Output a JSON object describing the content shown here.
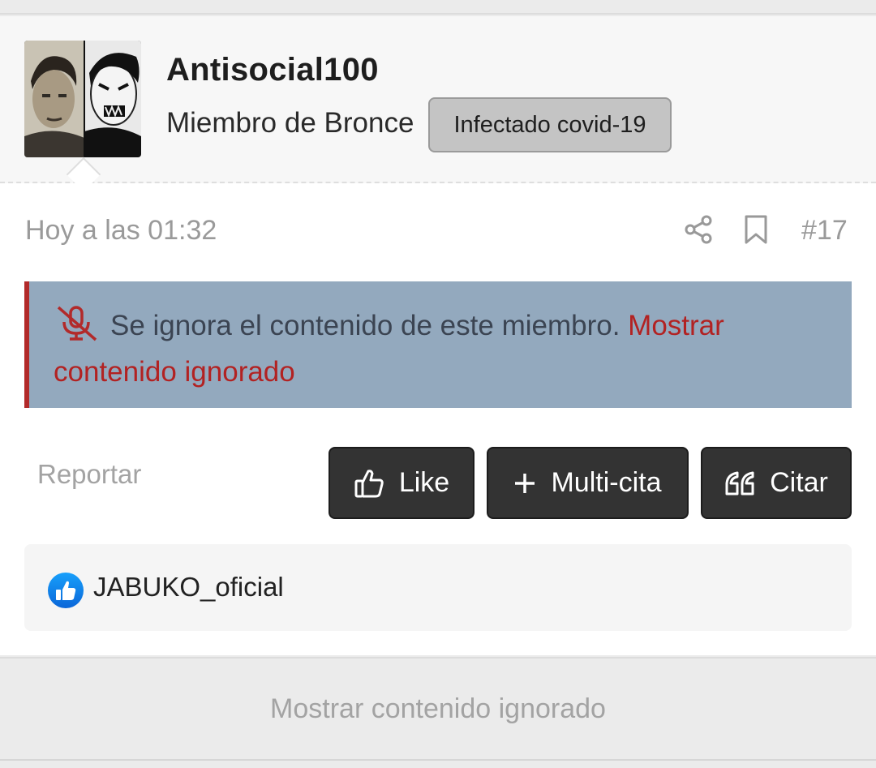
{
  "user": {
    "name": "Antisocial100",
    "title": "Miembro de Bronce",
    "banner": "Infectado covid-19"
  },
  "post": {
    "date": "Hoy a las 01:32",
    "number": "#17",
    "ignored_text": "Se ignora el contenido de este miembro.",
    "ignored_link": "Mostrar contenido ignorado"
  },
  "actions": {
    "report": "Reportar",
    "like": "Like",
    "multiquote": "Multi-cita",
    "quote": "Citar"
  },
  "reactions": {
    "users": "JABUKO_oficial"
  },
  "footer": {
    "show_ignored": "Mostrar contenido ignorado"
  },
  "colors": {
    "notice_bg": "#93a9be",
    "notice_accent": "#b22a2a",
    "button_bg": "#333333",
    "like_reaction": "#1877f2"
  },
  "icons": [
    "share-icon",
    "bookmark-icon",
    "mute-icon",
    "thumbs-up-icon",
    "plus-icon",
    "quote-icon",
    "like-reaction-icon"
  ]
}
